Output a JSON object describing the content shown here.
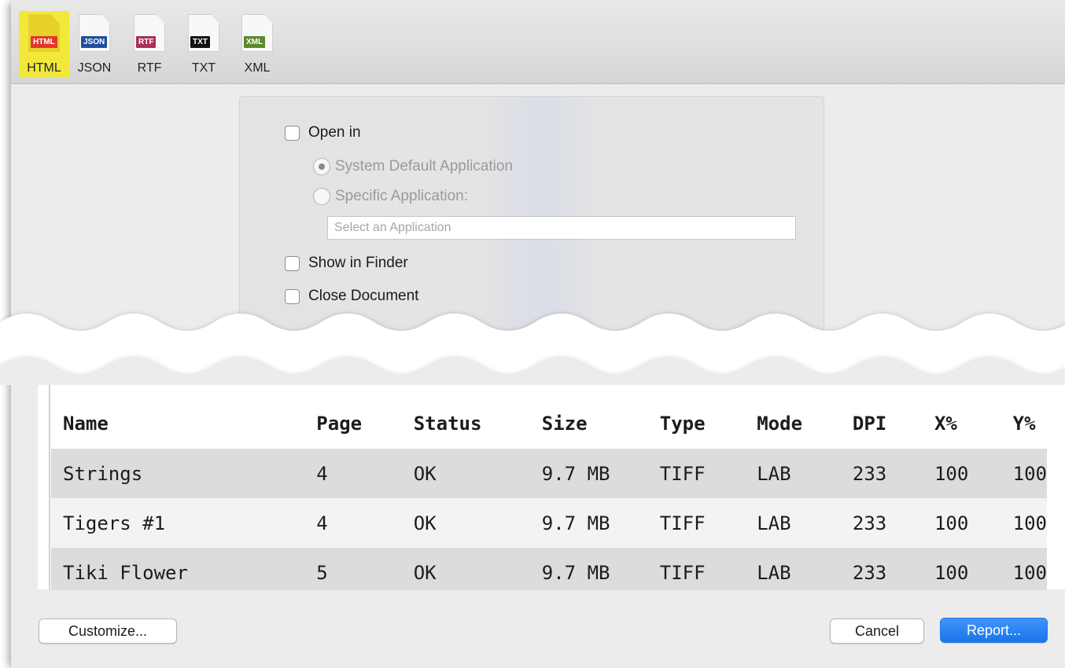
{
  "toolbar": {
    "formats": [
      {
        "tag": "HTML",
        "label": "HTML",
        "color": "#e2362b",
        "selected": true
      },
      {
        "tag": "JSON",
        "label": "JSON",
        "color": "#1f4f9e",
        "selected": false
      },
      {
        "tag": "RTF",
        "label": "RTF",
        "color": "#a8305a",
        "selected": false
      },
      {
        "tag": "TXT",
        "label": "TXT",
        "color": "#111111",
        "selected": false
      },
      {
        "tag": "XML",
        "label": "XML",
        "color": "#5a8a2c",
        "selected": false
      }
    ]
  },
  "options": {
    "open_in": {
      "label": "Open in",
      "checked": false
    },
    "system_default": {
      "label": "System Default Application",
      "selected": true
    },
    "specific_app": {
      "label": "Specific Application:",
      "selected": false
    },
    "app_field": {
      "placeholder": "Select an Application",
      "value": ""
    },
    "show_in_finder": {
      "label": "Show in Finder",
      "checked": false
    },
    "close_document": {
      "label": "Close Document",
      "checked": false
    }
  },
  "report_table": {
    "columns": [
      "Name",
      "Page",
      "Status",
      "Size",
      "Type",
      "Mode",
      "DPI",
      "X%",
      "Y%"
    ],
    "rows": [
      [
        "Strings",
        "4",
        "OK",
        "9.7 MB",
        "TIFF",
        "LAB",
        "233",
        "100",
        "100"
      ],
      [
        "Tigers #1",
        "4",
        "OK",
        "9.7 MB",
        "TIFF",
        "LAB",
        "233",
        "100",
        "100"
      ],
      [
        "Tiki Flower",
        "5",
        "OK",
        "9.7 MB",
        "TIFF",
        "LAB",
        "233",
        "100",
        "100"
      ]
    ]
  },
  "buttons": {
    "customize": "Customize...",
    "cancel": "Cancel",
    "report": "Report..."
  },
  "colors": {
    "selection_highlight": "#f2e83a",
    "primary_button": "#1b74ec"
  }
}
